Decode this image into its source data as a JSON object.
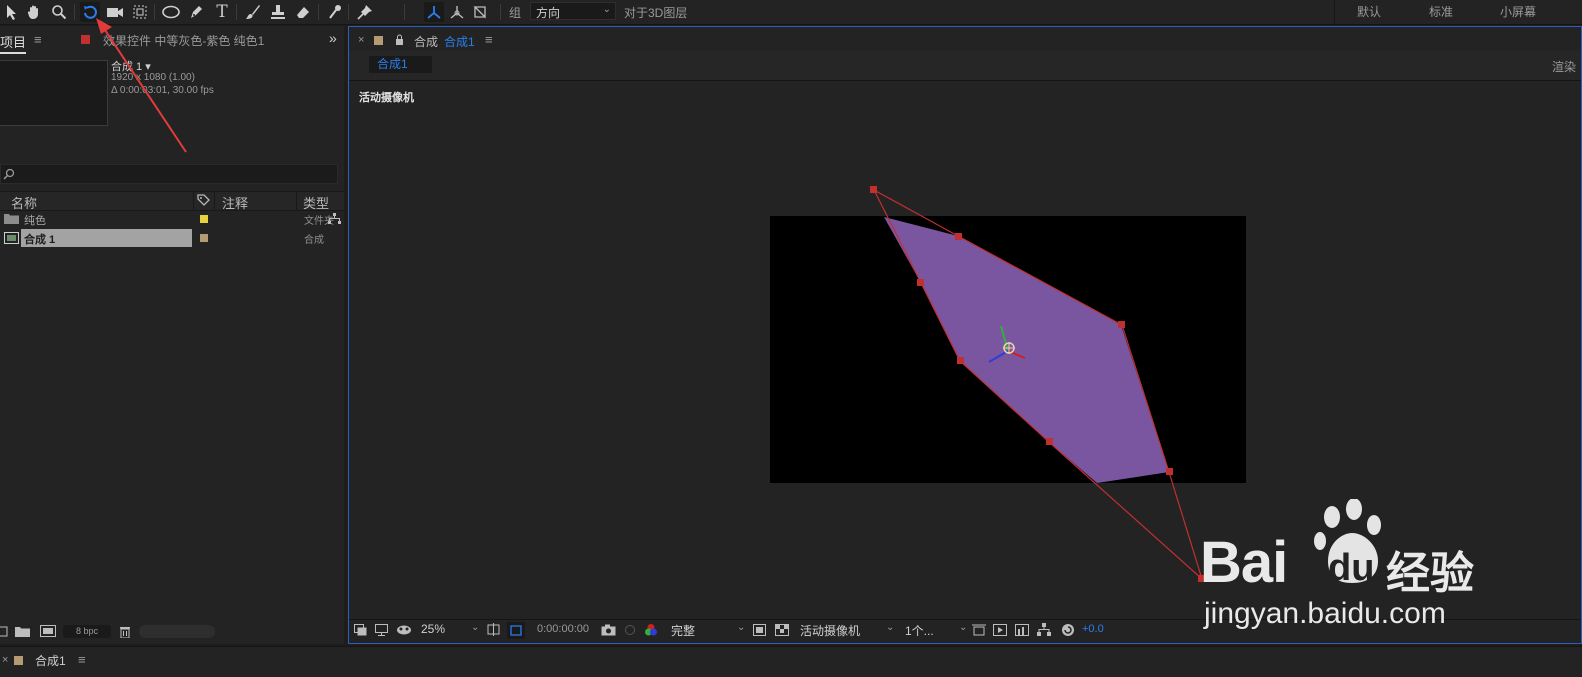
{
  "toolbar": {
    "group_label": "组",
    "orientation_value": "方向",
    "relative_3d_label": "对于3D图层",
    "workspaces": [
      "默认",
      "标准",
      "小屏幕"
    ],
    "accent": "#2a7ef0"
  },
  "project_panel": {
    "tab_label": "项目",
    "effects_tab_label": "效果控件 中等灰色-紫色 纯色1",
    "comp_name": "合成 1",
    "comp_resolution": "1920 x 1080 (1.00)",
    "comp_duration": "Δ 0:00:03:01, 30.00 fps",
    "columns": [
      "名称",
      "注释",
      "类型"
    ],
    "items": [
      {
        "name": "纯色",
        "type": "文件夹",
        "label_color": "#e6d23c",
        "selected": false
      },
      {
        "name": "合成 1",
        "type": "合成",
        "label_color": "#b49b73",
        "selected": true
      }
    ],
    "bit_depth": "8 bpc"
  },
  "viewer": {
    "tab_prefix": "合成",
    "tab_comp": "合成1",
    "breadcrumb": "合成1",
    "render_label": "渲染",
    "camera_label": "活动摄像机",
    "layer_color": "#7b56a0",
    "path_color": "#c03030"
  },
  "viewer_bar": {
    "zoom": "25%",
    "timecode": "0:00:00:00",
    "resolution": "完整",
    "camera": "活动摄像机",
    "views": "1个...",
    "exposure": "+0.0"
  },
  "status_bar": {
    "timeline_tab": "合成1"
  },
  "watermark": {
    "brand": "Bai",
    "brand_paw": "du",
    "service": "经验",
    "url": "jingyan.baidu.com"
  }
}
